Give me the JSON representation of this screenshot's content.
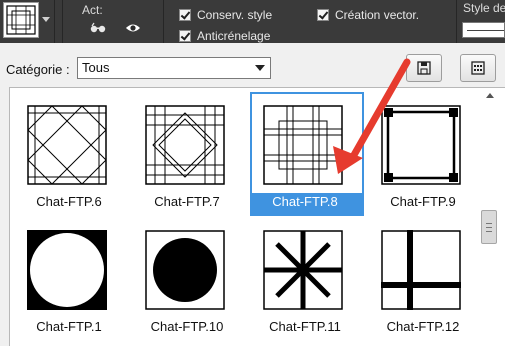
{
  "toolbar": {
    "act_label": "Act:",
    "conserv_style_label": "Conserv. style",
    "anticrenelage_label": "Anticrénelage",
    "creation_vector_label": "Création vector.",
    "style_label": "Style de",
    "conserv_style_checked": true,
    "anticrenelage_checked": true,
    "creation_vector_checked": true
  },
  "category": {
    "label": "Catégorie :",
    "selected": "Tous"
  },
  "shapes": [
    {
      "name": "Chat-FTP.6",
      "icon": "diamond-lattice-icon"
    },
    {
      "name": "Chat-FTP.7",
      "icon": "double-diamond-lattice-icon"
    },
    {
      "name": "Chat-FTP.8",
      "icon": "nested-squares-icon",
      "selected": true
    },
    {
      "name": "Chat-FTP.9",
      "icon": "square-corner-dots-icon"
    },
    {
      "name": "Chat-FTP.1",
      "icon": "circle-in-black-square-icon"
    },
    {
      "name": "Chat-FTP.10",
      "icon": "black-circle-icon"
    },
    {
      "name": "Chat-FTP.11",
      "icon": "asterisk-square-icon"
    },
    {
      "name": "Chat-FTP.12",
      "icon": "cross-lines-square-icon"
    }
  ],
  "colors": {
    "selection": "#3f93e0",
    "annotation_arrow": "#e63b2e",
    "toolbar_bg": "#3a3a3a"
  }
}
